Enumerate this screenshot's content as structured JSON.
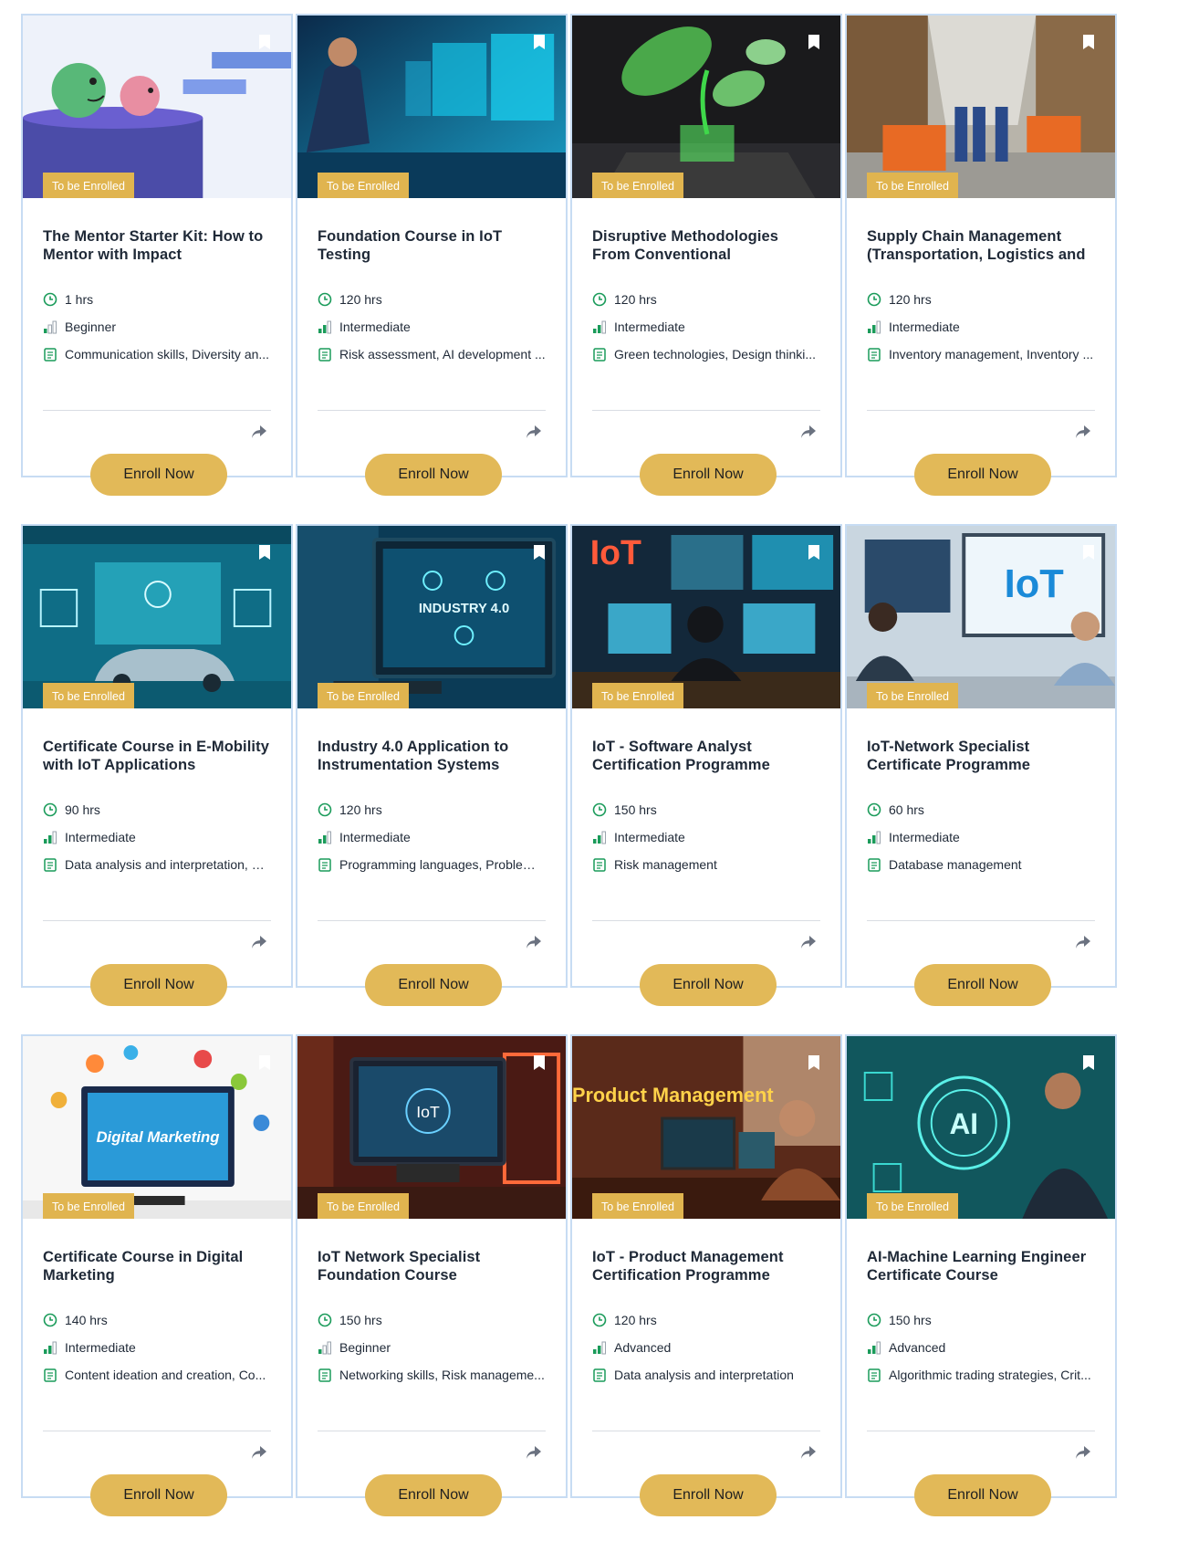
{
  "badge_label": "To be Enrolled",
  "enroll_label": "Enroll Now",
  "colors": {
    "accent": "#e2b958",
    "badge": "#e0b44f",
    "border": "#c7dcf3",
    "icon_green": "#1a9b5a"
  },
  "courses": [
    {
      "title": "The Mentor Starter Kit: How to Mentor with Impact",
      "duration": "1 hrs",
      "level": "Beginner",
      "skills": "Communication skills, Diversity an..."
    },
    {
      "title": "Foundation Course in IoT Testing",
      "duration": "120 hrs",
      "level": "Intermediate",
      "skills": "Risk assessment, AI development ..."
    },
    {
      "title": "Disruptive Methodologies From Conventional Technologies to",
      "duration": "120 hrs",
      "level": "Intermediate",
      "skills": "Green technologies, Design thinki..."
    },
    {
      "title": "Supply Chain Management (Transportation, Logistics and",
      "duration": "120 hrs",
      "level": "Intermediate",
      "skills": "Inventory management, Inventory ..."
    },
    {
      "title": "Certificate Course in E-Mobility with IoT Applications",
      "duration": "90 hrs",
      "level": "Intermediate",
      "skills": "Data analysis and interpretation, H..."
    },
    {
      "title": "Industry 4.0 Application to Instrumentation Systems",
      "duration": "120 hrs",
      "level": "Intermediate",
      "skills": "Programming languages, Problem ..."
    },
    {
      "title": "IoT - Software Analyst Certification Programme",
      "duration": "150 hrs",
      "level": "Intermediate",
      "skills": "Risk management"
    },
    {
      "title": "IoT-Network Specialist Certificate Programme",
      "duration": "60 hrs",
      "level": "Intermediate",
      "skills": "Database management"
    },
    {
      "title": "Certificate Course in Digital Marketing",
      "duration": "140 hrs",
      "level": "Intermediate",
      "skills": "Content ideation and creation, Co..."
    },
    {
      "title": "IoT Network Specialist Foundation Course",
      "duration": "150 hrs",
      "level": "Beginner",
      "skills": "Networking skills, Risk manageme..."
    },
    {
      "title": "IoT - Product Management Certification Programme",
      "duration": "120 hrs",
      "level": "Advanced",
      "skills": "Data analysis and interpretation"
    },
    {
      "title": "AI-Machine Learning Engineer Certificate Course",
      "duration": "150 hrs",
      "level": "Advanced",
      "skills": "Algorithmic trading strategies, Crit..."
    }
  ],
  "thumb_text": {
    "industry": "INDUSTRY 4.0",
    "iot_big": "IoT",
    "iot_small": "IoT",
    "iot_screen": "IoT",
    "digital": "Digital Marketing",
    "product": "Product Management",
    "ai": "AI"
  }
}
